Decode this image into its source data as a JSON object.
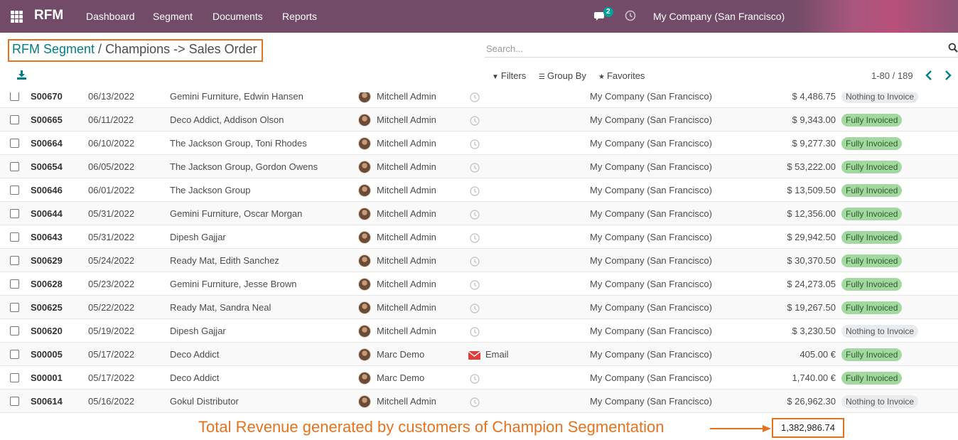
{
  "navbar": {
    "brand": "RFM",
    "menu": [
      "Dashboard",
      "Segment",
      "Documents",
      "Reports"
    ],
    "message_count": "2",
    "company": "My Company (San Francisco)",
    "accent": "#714b67"
  },
  "breadcrumb": {
    "parent": "RFM Segment",
    "separator": " / ",
    "current": "Champions -> Sales Order"
  },
  "search": {
    "placeholder": "Search..."
  },
  "toolbar": {
    "filters": "Filters",
    "group_by": "Group By",
    "favorites": "Favorites",
    "pager": "1-80 / 189"
  },
  "rows": [
    {
      "number": "S00670",
      "date": "06/13/2022",
      "customer": "Gemini Furniture, Edwin Hansen",
      "salesperson": "Mitchell Admin",
      "activity": "",
      "company": "My Company (San Francisco)",
      "total": "$ 4,486.75",
      "status": "Nothing to Invoice"
    },
    {
      "number": "S00665",
      "date": "06/11/2022",
      "customer": "Deco Addict, Addison Olson",
      "salesperson": "Mitchell Admin",
      "activity": "",
      "company": "My Company (San Francisco)",
      "total": "$ 9,343.00",
      "status": "Fully Invoiced"
    },
    {
      "number": "S00664",
      "date": "06/10/2022",
      "customer": "The Jackson Group, Toni Rhodes",
      "salesperson": "Mitchell Admin",
      "activity": "",
      "company": "My Company (San Francisco)",
      "total": "$ 9,277.30",
      "status": "Fully Invoiced"
    },
    {
      "number": "S00654",
      "date": "06/05/2022",
      "customer": "The Jackson Group, Gordon Owens",
      "salesperson": "Mitchell Admin",
      "activity": "",
      "company": "My Company (San Francisco)",
      "total": "$ 53,222.00",
      "status": "Fully Invoiced"
    },
    {
      "number": "S00646",
      "date": "06/01/2022",
      "customer": "The Jackson Group",
      "salesperson": "Mitchell Admin",
      "activity": "",
      "company": "My Company (San Francisco)",
      "total": "$ 13,509.50",
      "status": "Fully Invoiced"
    },
    {
      "number": "S00644",
      "date": "05/31/2022",
      "customer": "Gemini Furniture, Oscar Morgan",
      "salesperson": "Mitchell Admin",
      "activity": "",
      "company": "My Company (San Francisco)",
      "total": "$ 12,356.00",
      "status": "Fully Invoiced"
    },
    {
      "number": "S00643",
      "date": "05/31/2022",
      "customer": "Dipesh Gajjar",
      "salesperson": "Mitchell Admin",
      "activity": "",
      "company": "My Company (San Francisco)",
      "total": "$ 29,942.50",
      "status": "Fully Invoiced"
    },
    {
      "number": "S00629",
      "date": "05/24/2022",
      "customer": "Ready Mat, Edith Sanchez",
      "salesperson": "Mitchell Admin",
      "activity": "",
      "company": "My Company (San Francisco)",
      "total": "$ 30,370.50",
      "status": "Fully Invoiced"
    },
    {
      "number": "S00628",
      "date": "05/23/2022",
      "customer": "Gemini Furniture, Jesse Brown",
      "salesperson": "Mitchell Admin",
      "activity": "",
      "company": "My Company (San Francisco)",
      "total": "$ 24,273.05",
      "status": "Fully Invoiced"
    },
    {
      "number": "S00625",
      "date": "05/22/2022",
      "customer": "Ready Mat, Sandra Neal",
      "salesperson": "Mitchell Admin",
      "activity": "",
      "company": "My Company (San Francisco)",
      "total": "$ 19,267.50",
      "status": "Fully Invoiced"
    },
    {
      "number": "S00620",
      "date": "05/19/2022",
      "customer": "Dipesh Gajjar",
      "salesperson": "Mitchell Admin",
      "activity": "",
      "company": "My Company (San Francisco)",
      "total": "$ 3,230.50",
      "status": "Nothing to Invoice"
    },
    {
      "number": "S00005",
      "date": "05/17/2022",
      "customer": "Deco Addict",
      "salesperson": "Marc Demo",
      "activity": "Email",
      "company": "My Company (San Francisco)",
      "total": "405.00 €",
      "status": "Fully Invoiced"
    },
    {
      "number": "S00001",
      "date": "05/17/2022",
      "customer": "Deco Addict",
      "salesperson": "Marc Demo",
      "activity": "",
      "company": "My Company (San Francisco)",
      "total": "1,740.00 €",
      "status": "Fully Invoiced"
    },
    {
      "number": "S00614",
      "date": "05/16/2022",
      "customer": "Gokul Distributor",
      "salesperson": "Mitchell Admin",
      "activity": "",
      "company": "My Company (San Francisco)",
      "total": "$ 26,962.30",
      "status": "Nothing to Invoice"
    }
  ],
  "footer": {
    "annotation": "Total Revenue generated by customers of Champion Segmentation",
    "total": "1,382,986.74",
    "annotation_color": "#e4731f"
  },
  "colors": {
    "fully_invoiced_badge": "#a3d9a1",
    "nothing_badge": "#e9ecef",
    "link": "#017e84"
  }
}
